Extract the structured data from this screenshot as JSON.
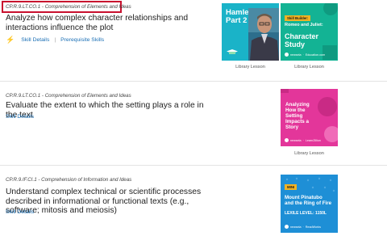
{
  "standards": [
    {
      "code": "CP.R.9.LT.CO.1 - Comprehension of Elements and Ideas",
      "title": "Analyze how complex character relationships and interactions influence the plot",
      "skill_details": "Skill Details",
      "prerequisite_skills": "Prerequisite Skills",
      "lessons": [
        {
          "title_line1": "Hamlet",
          "title_line2": "Part 2",
          "label": "Library Lesson"
        },
        {
          "badge": "Skill Builder:",
          "title_small": "Romeo and Juliet:",
          "title_big_line1": "Character",
          "title_big_line2": "Study",
          "footer_a": "newsela",
          "footer_b": "Education.com",
          "label": "Library Lesson"
        }
      ]
    },
    {
      "code": "CP.R.9.LT.CO.1 - Comprehension of Elements and Ideas",
      "title": "Evaluate the extent to which the setting plays a role in the text",
      "skill_details": "Skill Details",
      "lessons": [
        {
          "title_line1": "Analyzing",
          "title_line2": "How the",
          "title_line3": "Setting",
          "title_line4": "Impacts a",
          "title_line5": "Story",
          "footer_a": "newsela",
          "footer_b": "LearnZillion",
          "label": "Library Lesson"
        }
      ]
    },
    {
      "code": "CP.R.9.IF.CI.1 - Comprehension of Information and Ideas",
      "title": "Understand complex technical or scientific processes described in informational or functional texts (e.g., software; mitosis and meiosis)",
      "skill_details": "Skill Details",
      "lessons": [
        {
          "badge": "MINI",
          "title_line1": "Mount Pinatubo",
          "title_line2": "and the Ring of Fire",
          "lexile": "LEXILE LEVEL: 1150L",
          "footer_a": "newsela",
          "footer_b": "ReadWorks"
        }
      ]
    }
  ],
  "colors": {
    "link": "#1a6fb5",
    "highlight_border": "#c8102e",
    "hamlet_bg": "#1ab3c8",
    "romeo_bg": "#13b394",
    "analyze_bg": "#e3369a",
    "mount_bg": "#1e8fd6",
    "badge_yellow": "#f0b323"
  },
  "icons": {
    "fast_track": "lightning-bolt-icon"
  }
}
